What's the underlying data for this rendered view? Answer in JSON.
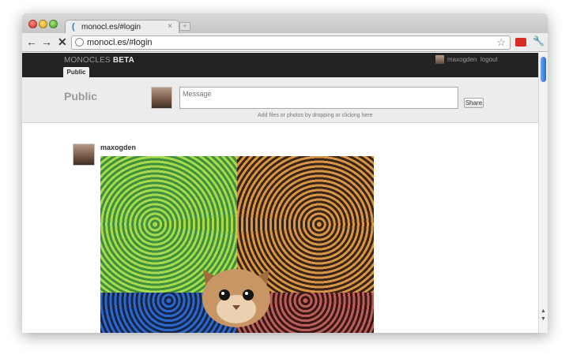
{
  "browser": {
    "tab_title": "monocl.es/#login",
    "tab_close": "×",
    "new_tab": "+",
    "url": "monocl.es/#login",
    "back": "←",
    "forward": "→",
    "stop": "✕",
    "star": "☆",
    "wrench": "🔧"
  },
  "app": {
    "brand_prefix": "MONOCLES",
    "brand_suffix": "BETA",
    "nav_public": "Public",
    "user_name": "maxogden",
    "logout": "logout"
  },
  "compose": {
    "title": "Public",
    "message_placeholder": "Message",
    "share_label": "Share",
    "dropzone_text": "Add files or photos by dropping or clicking here"
  },
  "post": {
    "author": "maxogden"
  },
  "colors": {
    "header_bg": "#232323",
    "compose_bg": "#ececec",
    "scroll_accent": "#3a78d8"
  },
  "icons": [
    "back-icon",
    "forward-icon",
    "stop-icon",
    "globe-icon",
    "star-icon",
    "extension-icon",
    "wrench-icon",
    "scroll-up-icon",
    "scroll-down-icon"
  ]
}
